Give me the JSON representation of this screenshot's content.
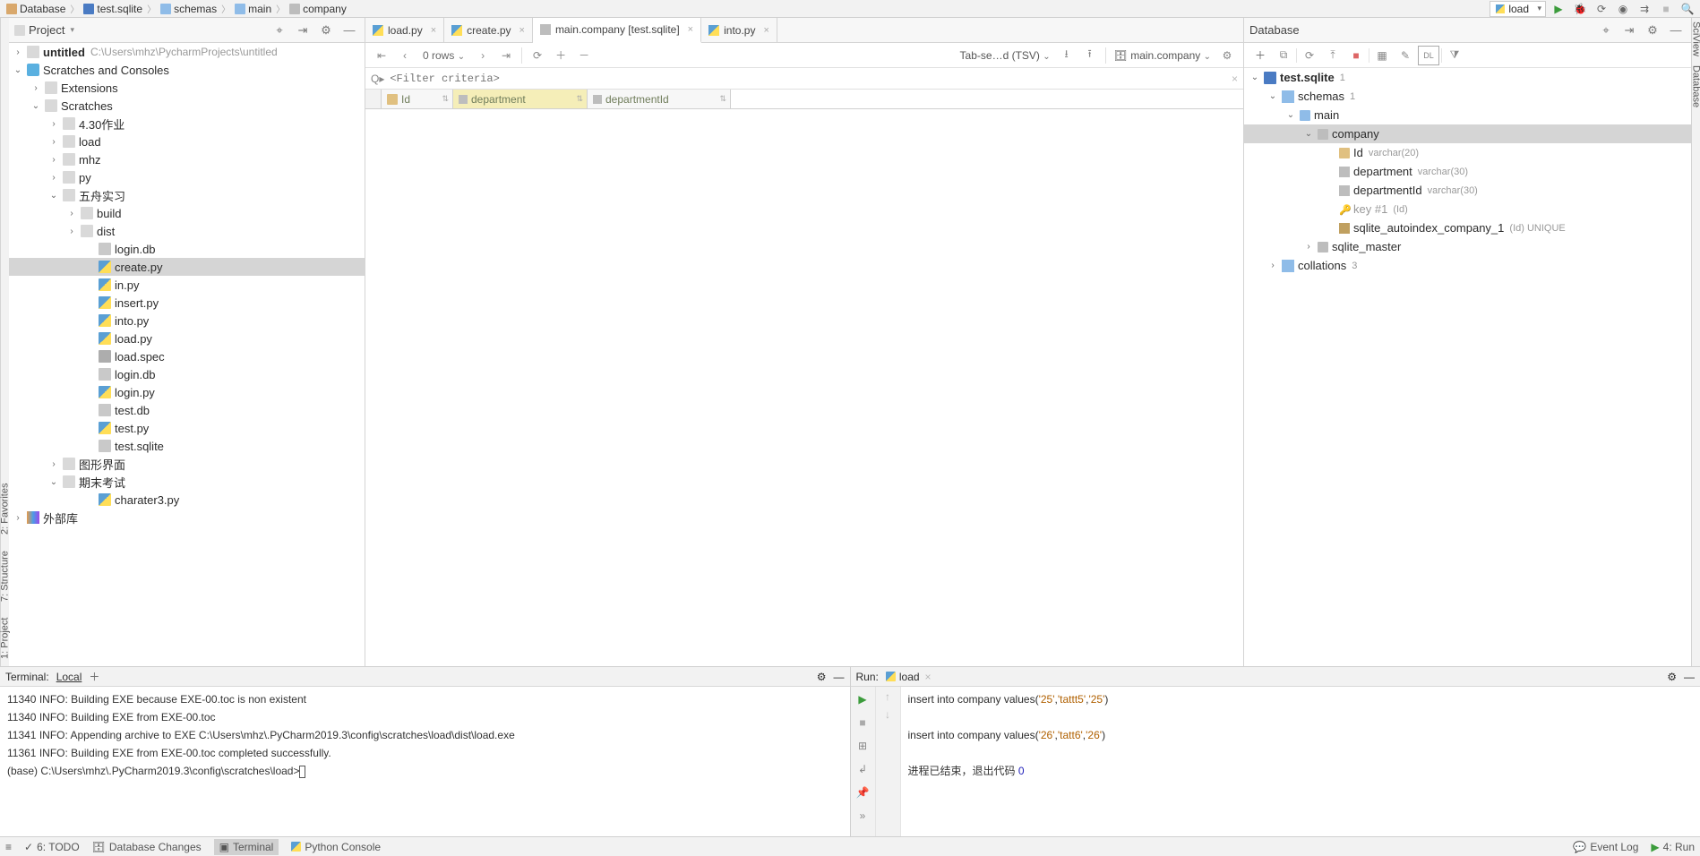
{
  "breadcrumb": [
    "Database",
    "test.sqlite",
    "schemas",
    "main",
    "company"
  ],
  "run_config": "load",
  "project_panel": {
    "title": "Project",
    "root_name": "untitled",
    "root_path": "C:\\Users\\mhz\\PycharmProjects\\untitled",
    "scratches": "Scratches and Consoles",
    "extensions": "Extensions",
    "scratches_folder": "Scratches",
    "children": {
      "c430": "4.30作业",
      "load": "load",
      "mhz": "mhz",
      "py": "py",
      "wuzhou": "五舟实习",
      "build": "build",
      "dist": "dist",
      "login_db": "login.db",
      "create_py": "create.py",
      "in_py": "in.py",
      "insert_py": "insert.py",
      "into_py": "into.py",
      "load_py": "load.py",
      "load_spec": "load.spec",
      "login_db2": "login.db",
      "login_py": "login.py",
      "test_db": "test.db",
      "test_py": "test.py",
      "test_sqlite": "test.sqlite",
      "tuxing": "图形界面",
      "qimo": "期末考试",
      "charater3": "charater3.py",
      "external": "外部库"
    }
  },
  "editor_tabs": {
    "t1": "load.py",
    "t2": "create.py",
    "t3": "main.company [test.sqlite]",
    "t4": "into.py"
  },
  "grid_toolbar": {
    "rows": "0 rows",
    "export": "Tab-se…d (TSV)",
    "table": "main.company"
  },
  "filter_placeholder": "<Filter criteria>",
  "columns": {
    "id": "Id",
    "dep": "department",
    "depid": "departmentId"
  },
  "db_panel": {
    "title": "Database",
    "root": "test.sqlite",
    "root_badge": "1",
    "schemas": "schemas",
    "schemas_badge": "1",
    "main": "main",
    "company": "company",
    "col_id": "Id",
    "col_id_type": "varchar(20)",
    "col_dep": "department",
    "col_dep_type": "varchar(30)",
    "col_depid": "departmentId",
    "col_depid_type": "varchar(30)",
    "key": "key #1",
    "key_note": "(Id)",
    "autoidx": "sqlite_autoindex_company_1",
    "autoidx_note": "(Id) UNIQUE",
    "sqlite_master": "sqlite_master",
    "collations": "collations",
    "collations_badge": "3"
  },
  "terminal": {
    "title": "Terminal:",
    "tab": "Local",
    "lines": [
      "11340 INFO: Building EXE because EXE-00.toc is non existent",
      "11340 INFO: Building EXE from EXE-00.toc",
      "11341 INFO: Appending archive to EXE C:\\Users\\mhz\\.PyCharm2019.3\\config\\scratches\\load\\dist\\load.exe",
      "11361 INFO: Building EXE from EXE-00.toc completed successfully.",
      "",
      "(base) C:\\Users\\mhz\\.PyCharm2019.3\\config\\scratches\\load>"
    ]
  },
  "run": {
    "title": "Run:",
    "name": "load",
    "l1a": "insert into company values(",
    "l1b": "'25'",
    "l1c": ",",
    "l1d": "'tattt5'",
    "l1e": ",",
    "l1f": "'25'",
    "l1g": ")",
    "l2a": "insert into company values(",
    "l2b": "'26'",
    "l2c": ",",
    "l2d": "'tatt6'",
    "l2e": ",",
    "l2f": "'26'",
    "l2g": ")",
    "exit_pre": "进程已结束，退出代码 ",
    "exit_code": "0"
  },
  "status": {
    "todo": "6: TODO",
    "dbchanges": "Database Changes",
    "terminal": "Terminal",
    "pycon": "Python Console",
    "eventlog": "Event Log",
    "run": "4: Run"
  },
  "sidebars": {
    "project": "1: Project",
    "structure": "7: Structure",
    "favorites": "2: Favorites",
    "sciview": "SciView",
    "database": "Database"
  }
}
